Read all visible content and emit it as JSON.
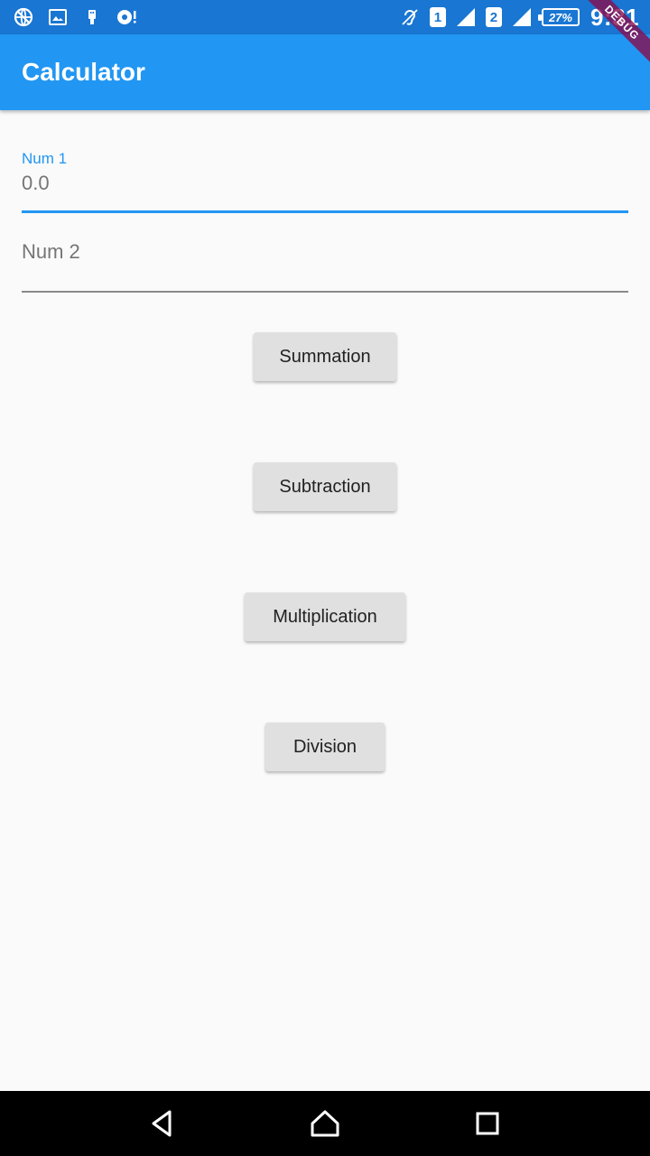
{
  "status_bar": {
    "left_icons": [
      "vpn-globe-icon",
      "image-icon",
      "usb-icon",
      "sync-alert-icon"
    ],
    "right_icons": [
      "hearing-aid-icon",
      "sim1-signal-icon",
      "sim2-signal-icon",
      "battery-icon"
    ],
    "sim1_label": "1",
    "sim2_label": "2",
    "battery_text": "27%",
    "clock": "9:31",
    "color": "#1976d2"
  },
  "debug_banner": {
    "label": "DEBUG"
  },
  "app_bar": {
    "title": "Calculator",
    "color": "#2196f3"
  },
  "form": {
    "num1": {
      "label": "Num 1",
      "value": "0.0"
    },
    "num2": {
      "placeholder": "Num 2",
      "value": ""
    }
  },
  "buttons": {
    "summation": "Summation",
    "subtraction": "Subtraction",
    "multiplication": "Multiplication",
    "division": "Division"
  },
  "nav_bar": {
    "icons": [
      "back-icon",
      "home-icon",
      "recents-icon"
    ]
  }
}
